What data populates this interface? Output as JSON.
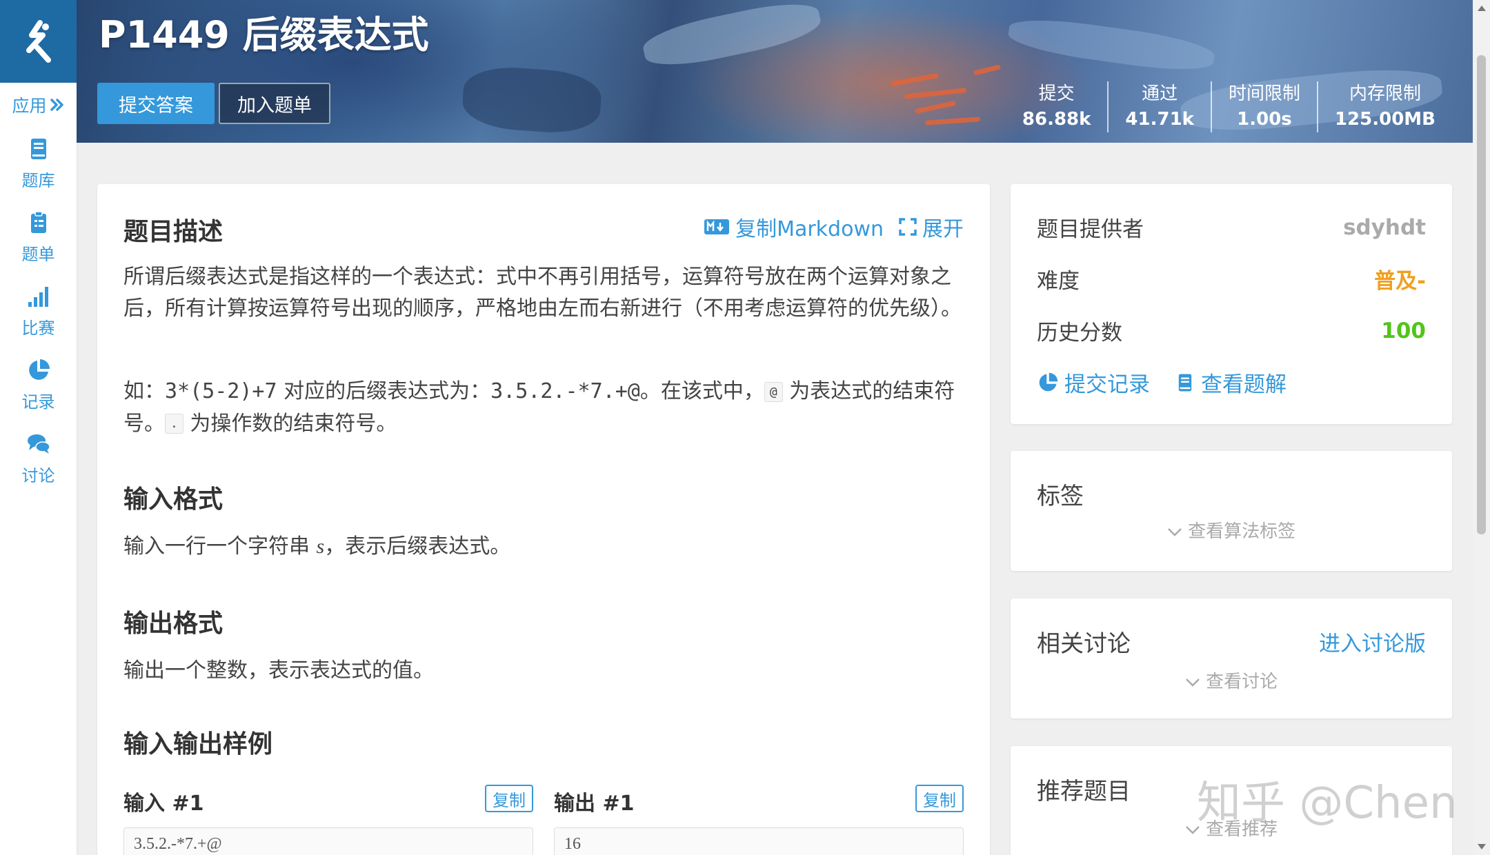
{
  "sidebar": {
    "apps_label": "应用",
    "items": [
      {
        "label": "题库",
        "icon": "book-icon"
      },
      {
        "label": "题单",
        "icon": "clipboard-icon"
      },
      {
        "label": "比赛",
        "icon": "bar-chart-icon"
      },
      {
        "label": "记录",
        "icon": "pie-chart-icon"
      },
      {
        "label": "讨论",
        "icon": "chat-bubbles-icon"
      }
    ]
  },
  "header": {
    "title": "P1449 后缀表达式",
    "submit_label": "提交答案",
    "add_label": "加入题单",
    "stats": [
      {
        "label": "提交",
        "value": "86.88k"
      },
      {
        "label": "通过",
        "value": "41.71k"
      },
      {
        "label": "时间限制",
        "value": "1.00s"
      },
      {
        "label": "内存限制",
        "value": "125.00MB"
      }
    ]
  },
  "problem": {
    "description_heading": "题目描述",
    "copy_markdown": "复制Markdown",
    "expand": "展开",
    "desc_p1": "所谓后缀表达式是指这样的一个表达式：式中不再引用括号，运算符号放在两个运算对象之后，所有计算按运算符号出现的顺序，严格地由左而右新进行（不用考虑运算符的优先级）。",
    "desc_p2_prefix": "如：",
    "desc_p2_expr1": "3*(5-2)+7",
    "desc_p2_mid": " 对应的后缀表达式为：",
    "desc_p2_expr2": "3.5.2.-*7.+@",
    "desc_p2_mid2": "。在该式中，",
    "desc_p2_at": "@",
    "desc_p2_mid3": " 为表达式的结束符号。",
    "desc_p2_dot": ".",
    "desc_p2_end": " 为操作数的结束符号。",
    "input_heading": "输入格式",
    "input_text_prefix": "输入一行一个字符串 ",
    "input_var": "s",
    "input_text_suffix": "，表示后缀表达式。",
    "output_heading": "输出格式",
    "output_text": "输出一个整数，表示表达式的值。",
    "samples_heading": "输入输出样例",
    "input1_label": "输入 #1",
    "output1_label": "输出 #1",
    "copy_label": "复制",
    "input1_value": "3.5.2.-*7.+@",
    "output1_value": "16"
  },
  "info": {
    "provider_label": "题目提供者",
    "provider_value": "sdyhdt",
    "difficulty_label": "难度",
    "difficulty_value": "普及-",
    "score_label": "历史分数",
    "score_value": "100",
    "records_link": "提交记录",
    "solutions_link": "查看题解"
  },
  "tags": {
    "title": "标签",
    "expand": "查看算法标签"
  },
  "discuss": {
    "title": "相关讨论",
    "enter_link": "进入讨论版",
    "expand": "查看讨论"
  },
  "recommend": {
    "title": "推荐题目",
    "expand": "查看推荐"
  },
  "watermark": "知乎 @Chen",
  "colors": {
    "brand": "#1e6aa3",
    "accent": "#3498db",
    "difficulty": "#f0a020",
    "score": "#52c41a"
  }
}
